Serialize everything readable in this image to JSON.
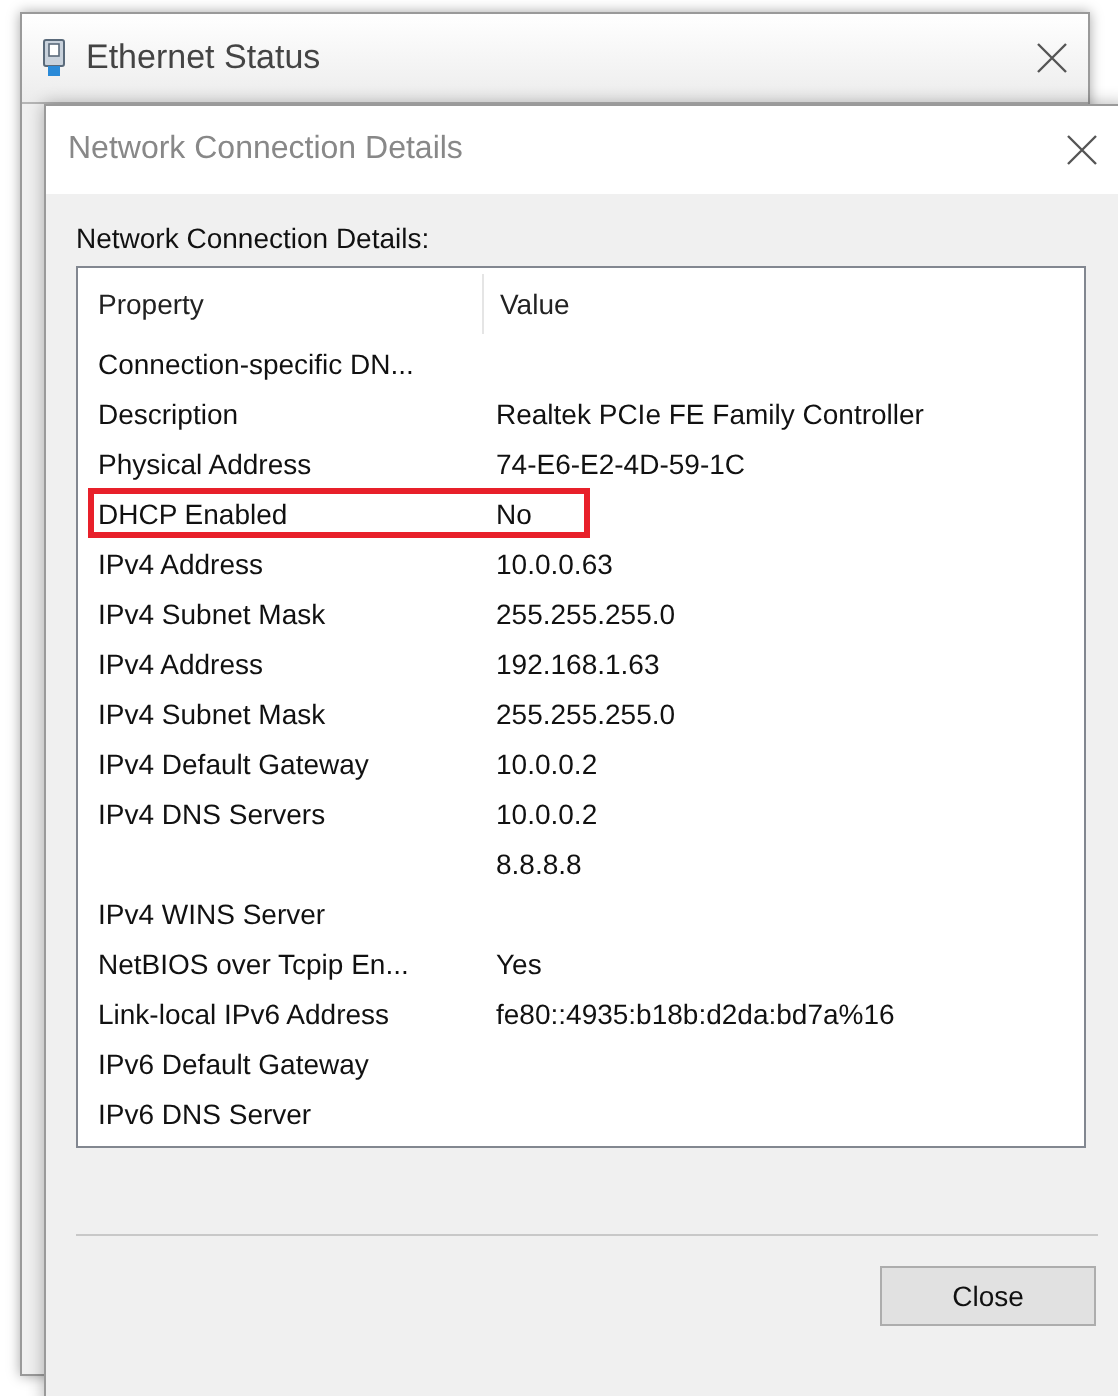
{
  "back_window": {
    "title": "Ethernet Status"
  },
  "dialog": {
    "title": "Network Connection Details",
    "label": "Network Connection Details:",
    "columns": [
      "Property",
      "Value"
    ],
    "rows": [
      {
        "property": "Connection-specific DN...",
        "value": "",
        "highlighted": false
      },
      {
        "property": "Description",
        "value": "Realtek PCIe FE Family Controller",
        "highlighted": false
      },
      {
        "property": "Physical Address",
        "value": "74-E6-E2-4D-59-1C",
        "highlighted": false
      },
      {
        "property": "DHCP Enabled",
        "value": "No",
        "highlighted": true
      },
      {
        "property": "IPv4 Address",
        "value": "10.0.0.63",
        "highlighted": false
      },
      {
        "property": "IPv4 Subnet Mask",
        "value": "255.255.255.0",
        "highlighted": false
      },
      {
        "property": "IPv4 Address",
        "value": "192.168.1.63",
        "highlighted": false
      },
      {
        "property": "IPv4 Subnet Mask",
        "value": "255.255.255.0",
        "highlighted": false
      },
      {
        "property": "IPv4 Default Gateway",
        "value": "10.0.0.2",
        "highlighted": false
      },
      {
        "property": "IPv4 DNS Servers",
        "value": "10.0.0.2",
        "highlighted": false
      },
      {
        "property": "",
        "value": "8.8.8.8",
        "highlighted": false
      },
      {
        "property": "IPv4 WINS Server",
        "value": "",
        "highlighted": false
      },
      {
        "property": "NetBIOS over Tcpip En...",
        "value": "Yes",
        "highlighted": false
      },
      {
        "property": "Link-local IPv6 Address",
        "value": "fe80::4935:b18b:d2da:bd7a%16",
        "highlighted": false
      },
      {
        "property": "IPv6 Default Gateway",
        "value": "",
        "highlighted": false
      },
      {
        "property": "IPv6 DNS Server",
        "value": "",
        "highlighted": false
      }
    ],
    "buttons": [
      "Close"
    ]
  }
}
